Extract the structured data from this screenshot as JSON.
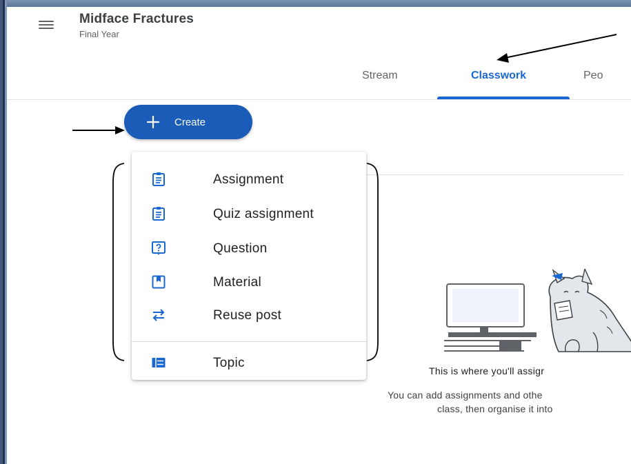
{
  "header": {
    "class_title": "Midface Fractures",
    "class_subtitle": "Final Year",
    "tabs": [
      {
        "label": "Stream",
        "active": false
      },
      {
        "label": "Classwork",
        "active": true
      },
      {
        "label": "Peo",
        "active": false
      }
    ]
  },
  "create_button": {
    "label": "Create",
    "icon": "plus-icon"
  },
  "create_menu": {
    "items": [
      {
        "label": "Assignment",
        "icon": "assignment-icon"
      },
      {
        "label": "Quiz assignment",
        "icon": "quiz-assignment-icon"
      },
      {
        "label": "Question",
        "icon": "question-icon"
      },
      {
        "label": "Material",
        "icon": "material-icon"
      },
      {
        "label": "Reuse post",
        "icon": "reuse-post-icon"
      },
      {
        "label": "Topic",
        "icon": "topic-icon"
      }
    ]
  },
  "empty_state": {
    "title": "This is where you'll assigr",
    "description_line1": "You can add assignments and othe",
    "description_line2": "class, then organise it into"
  },
  "colors": {
    "accent": "#1967d2",
    "create_button": "#1a5cb7",
    "frame": "#6d86a8"
  }
}
